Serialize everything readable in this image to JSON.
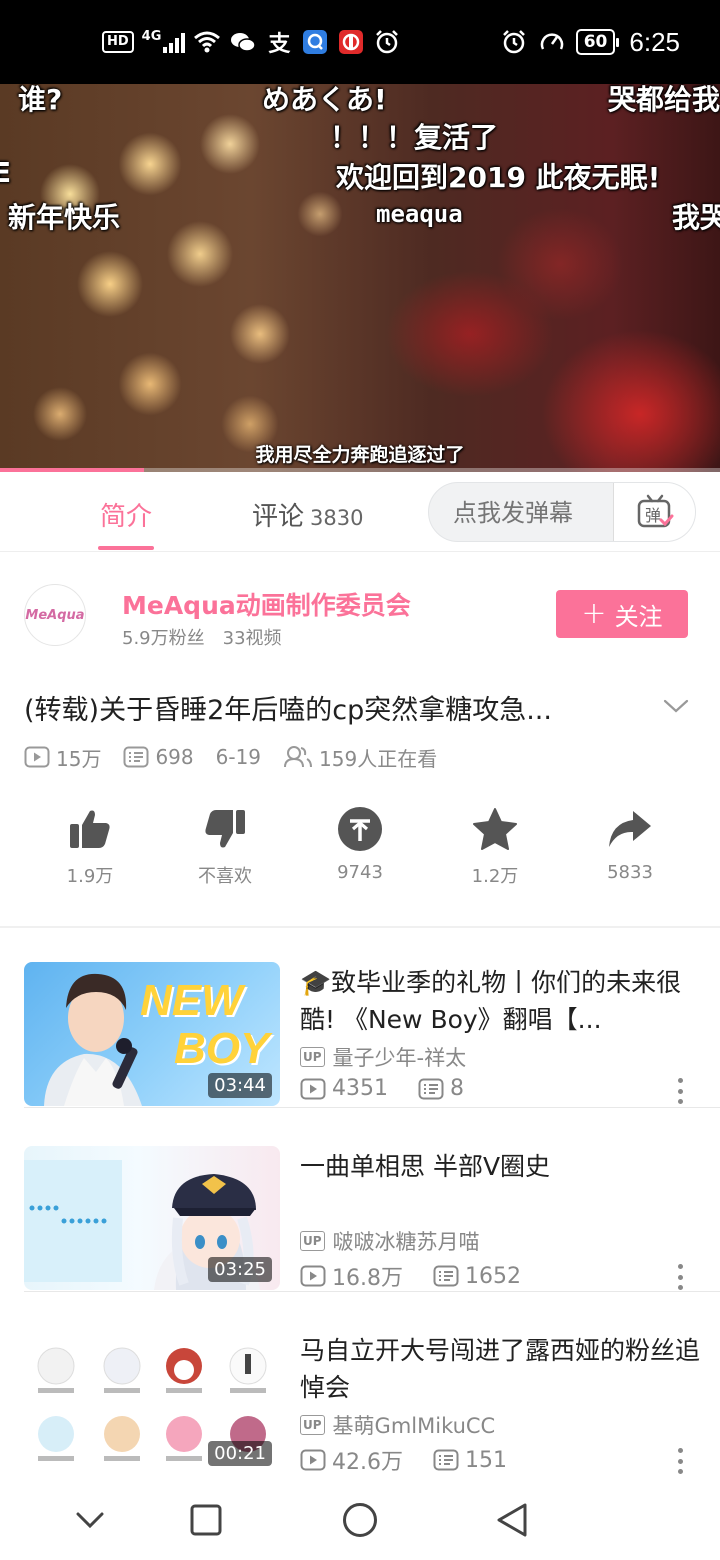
{
  "status_bar": {
    "hd": "HD",
    "network": "4G",
    "battery": "60",
    "time": "6:25",
    "icons": [
      "signal-icon",
      "wifi-icon",
      "wechat-icon",
      "alipay-icon",
      "message-icon",
      "bank-icon",
      "alarm-icon",
      "alarm-clock-icon",
      "speed-icon"
    ]
  },
  "player": {
    "danmaku": [
      "谁?",
      "めあくあ!",
      "哭都给我",
      "！！！复活了",
      "欢迎回到2019  此夜无眠!",
      "新年快乐",
      "meaqua",
      "我哭",
      "E"
    ],
    "subtitle": "我用尽全力奔跑追逐过了",
    "progress": 0.2
  },
  "tabs": {
    "intro": "简介",
    "comments": "评论",
    "comments_count": "3830",
    "danmu_placeholder": "点我发弹幕",
    "danmu_button": "弹"
  },
  "uploader": {
    "avatar_text": "MeAqua",
    "name": "MeAqua动画制作委员会",
    "fans": "5.9万粉丝",
    "videos": "33视频",
    "follow_label": "关注"
  },
  "video": {
    "title": "(转载)关于昏睡2年后嗑的cp突然拿糖攻急...",
    "plays": "15万",
    "danmaku_count": "698",
    "date": "6-19",
    "watching": "159人正在看"
  },
  "actions": [
    {
      "icon": "thumbs-up-icon",
      "label": "1.9万"
    },
    {
      "icon": "thumbs-down-icon",
      "label": "不喜欢"
    },
    {
      "icon": "coin-icon",
      "label": "9743"
    },
    {
      "icon": "star-icon",
      "label": "1.2万"
    },
    {
      "icon": "share-icon",
      "label": "5833"
    }
  ],
  "related": [
    {
      "title": "🎓致毕业季的礼物丨你们的未来很酷! 《New Boy》翻唱【...",
      "up_tag": "UP",
      "up": "量子少年-祥太",
      "plays": "4351",
      "danmaku": "8",
      "duration": "03:44",
      "thumb_text_1": "NEW",
      "thumb_text_2": "BOY"
    },
    {
      "title": "一曲单相思 半部V圈史",
      "up_tag": "UP",
      "up": "啵啵冰糖苏月喵",
      "plays": "16.8万",
      "danmaku": "1652",
      "duration": "03:25"
    },
    {
      "title": "马自立开大号闯进了露西娅的粉丝追悼会",
      "up_tag": "UP",
      "up": "基萌GmlMikuCC",
      "plays": "42.6万",
      "danmaku": "151",
      "duration": "00:21"
    }
  ],
  "navbar": [
    "back-chevron-icon",
    "recent-apps-icon",
    "home-icon",
    "back-triangle-icon"
  ]
}
